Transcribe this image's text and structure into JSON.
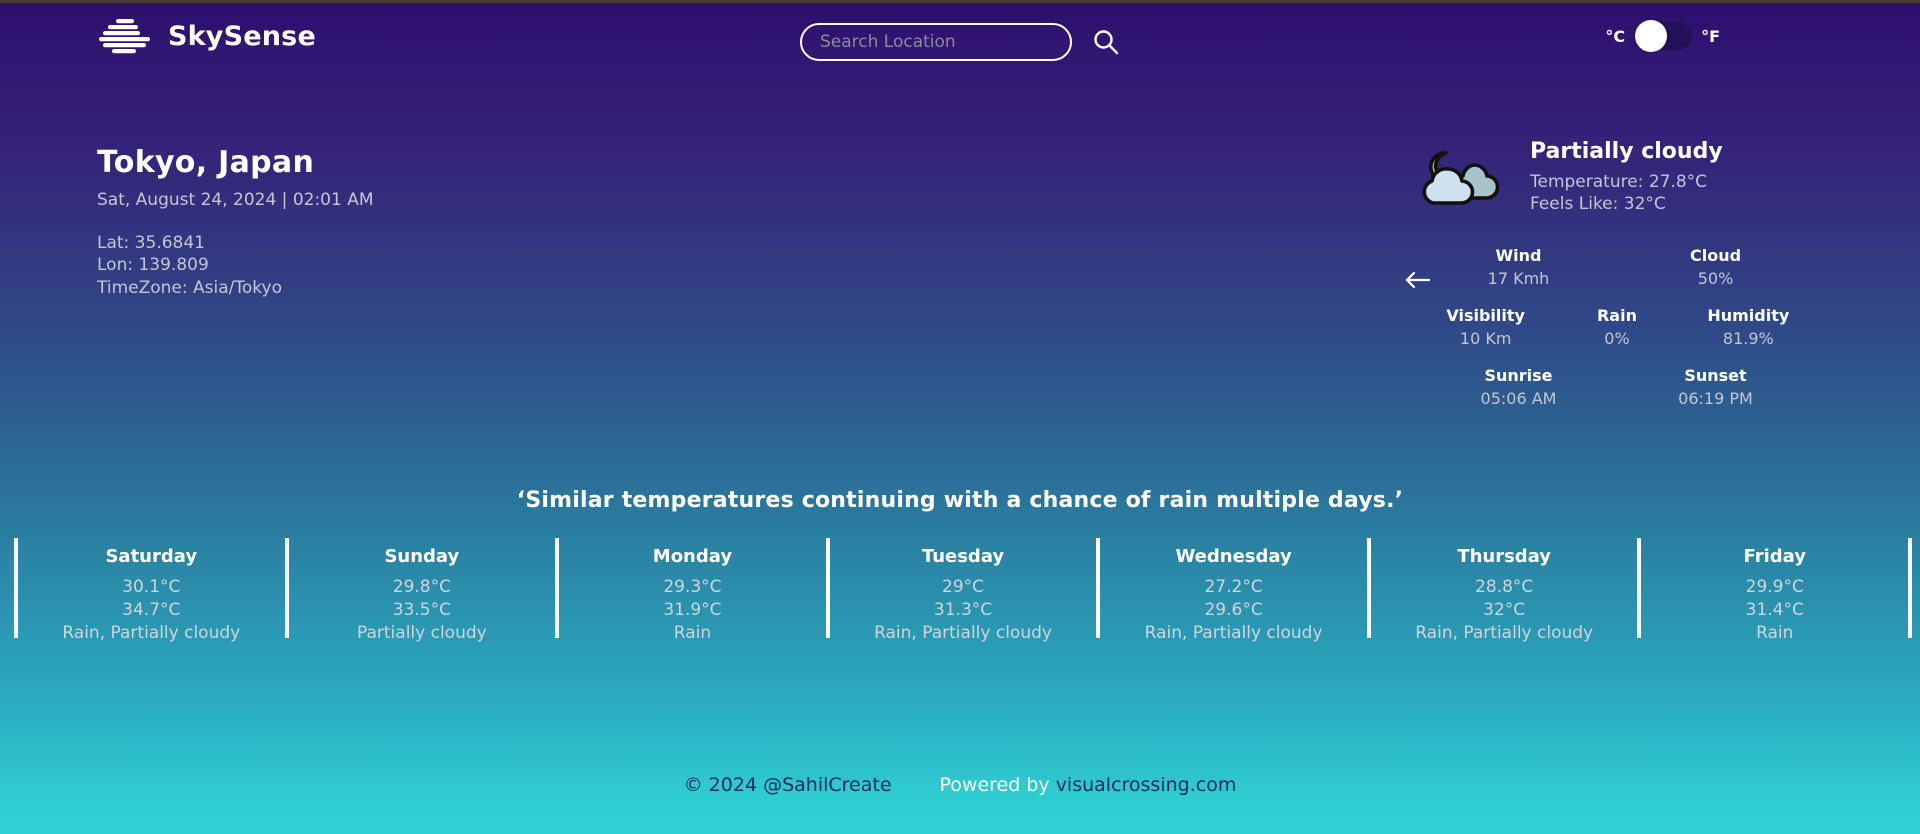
{
  "brand": {
    "name": "SkySense",
    "logo_icon": "cloud-logo-icon"
  },
  "search": {
    "placeholder": "Search Location",
    "value": "",
    "icon": "search-icon"
  },
  "units": {
    "celsius_label": "°C",
    "fahrenheit_label": "°F",
    "selected": "celsius"
  },
  "location": {
    "city": "Tokyo, Japan",
    "datetime": "Sat, August 24, 2024 | 02:01 AM",
    "lat": "Lat: 35.6841",
    "lon": "Lon: 139.809",
    "timezone": "TimeZone: Asia/Tokyo"
  },
  "current": {
    "icon": "moon-behind-cloud-icon",
    "condition": "Partially cloudy",
    "temperature": "Temperature: 27.8°C",
    "feels_like": "Feels Like: 32°C",
    "wind_arrow_icon": "arrow-left-icon",
    "stats": [
      {
        "label": "Wind",
        "value": "17 Kmh"
      },
      {
        "label": "Cloud",
        "value": "50%"
      },
      {
        "label": "Visibility",
        "value": "10 Km"
      },
      {
        "label": "Rain",
        "value": "0%"
      },
      {
        "label": "Humidity",
        "value": "81.9%"
      },
      {
        "label": "Sunrise",
        "value": "05:06 AM"
      },
      {
        "label": "Sunset",
        "value": "06:19 PM"
      }
    ]
  },
  "headline": "‘Similar temperatures continuing with a chance of rain multiple days.’",
  "forecast": [
    {
      "day": "Saturday",
      "low": "30.1°C",
      "high": "34.7°C",
      "condition": "Rain, Partially cloudy"
    },
    {
      "day": "Sunday",
      "low": "29.8°C",
      "high": "33.5°C",
      "condition": "Partially cloudy"
    },
    {
      "day": "Monday",
      "low": "29.3°C",
      "high": "31.9°C",
      "condition": "Rain"
    },
    {
      "day": "Tuesday",
      "low": "29°C",
      "high": "31.3°C",
      "condition": "Rain, Partially cloudy"
    },
    {
      "day": "Wednesday",
      "low": "27.2°C",
      "high": "29.6°C",
      "condition": "Rain, Partially cloudy"
    },
    {
      "day": "Thursday",
      "low": "28.8°C",
      "high": "32°C",
      "condition": "Rain, Partially cloudy"
    },
    {
      "day": "Friday",
      "low": "29.9°C",
      "high": "31.4°C",
      "condition": "Rain"
    }
  ],
  "footer": {
    "copyright": "© 2024 @SahilCreate",
    "powered_prefix": "Powered by ",
    "powered_link": "visualcrossing.com"
  },
  "colors": {
    "gradient_top": "#2d0e6e",
    "gradient_mid": "#2c6492",
    "gradient_bottom": "#2fd2d4",
    "accent_white": "#ffffff",
    "muted_text": "#c3c7d3",
    "footer_dark": "#1e2a63",
    "moon": "#f5b942"
  }
}
